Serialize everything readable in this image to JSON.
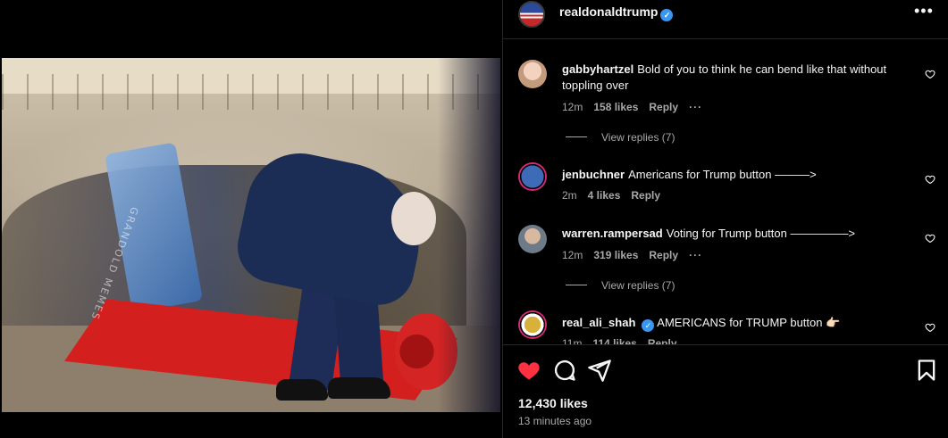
{
  "post": {
    "author": "realdonaldtrump",
    "verified_badge": "✓",
    "more_icon": "more-horizontal-icon",
    "watermark": "GRANDOLD MEMES",
    "likes_text": "12,430 likes",
    "timestamp": "13 minutes ago"
  },
  "comments": [
    {
      "username": "gabbyhartzel",
      "text": "Bold of you to think he can bend like that without toppling over",
      "time": "12m",
      "likes": "158 likes",
      "reply": "Reply",
      "more": "···",
      "view_replies": "View replies (7)"
    },
    {
      "username": "jenbuchner",
      "text": "Americans for Trump button ———>",
      "time": "2m",
      "likes": "4 likes",
      "reply": "Reply"
    },
    {
      "username": "warren.rampersad",
      "text": "Voting for Trump button —————>",
      "time": "12m",
      "likes": "319 likes",
      "reply": "Reply",
      "more": "···",
      "view_replies": "View replies (7)"
    },
    {
      "username": "real_ali_shah",
      "verified_badge": "✓",
      "text": "AMERICANS for TRUMP button 👉🏻",
      "time": "11m",
      "likes": "114 likes",
      "reply": "Reply"
    }
  ],
  "icons": {
    "like": "heart-filled-icon",
    "comment": "comment-icon",
    "share": "share-icon",
    "save": "bookmark-icon",
    "comment_like": "heart-outline-icon"
  },
  "colors": {
    "like_red": "#ff3040",
    "verified_blue": "#3897f0",
    "secondary_text": "#a8a8a8"
  }
}
